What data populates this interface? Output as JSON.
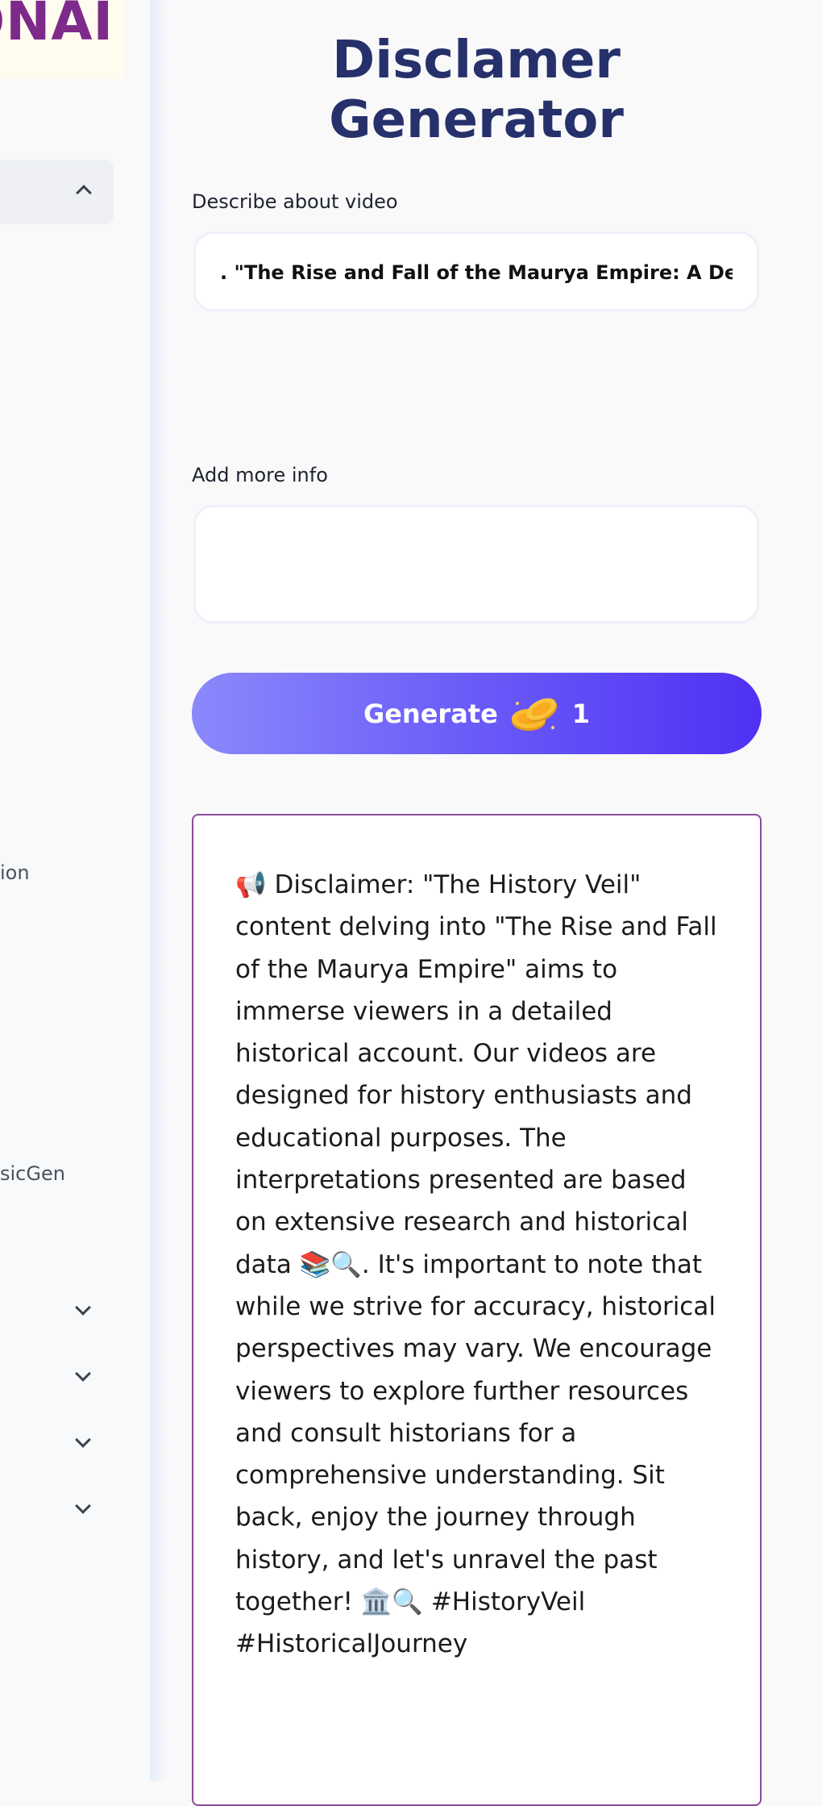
{
  "sidebar": {
    "logo_text": "ONAI",
    "labels": [
      "ion",
      "sicGen"
    ]
  },
  "main": {
    "title": "Disclamer Generator",
    "describe_label": "Describe about video",
    "describe_value": ". \"The Rise and Fall of the Maurya Empire: A Detailed",
    "more_info_label": "Add more info",
    "more_info_value": "",
    "generate_label": "Generate",
    "generate_cost": "1",
    "output_text": "📢 Disclaimer: \"The History Veil\" content delving into \"The Rise and Fall of the Maurya Empire\" aims to immerse viewers in a detailed historical account. Our videos are designed for history enthusiasts and educational purposes. The interpretations presented are based on extensive research and historical data 📚🔍. It's important to note that while we strive for accuracy, historical perspectives may vary. We encourage viewers to explore further resources and consult historians for a comprehensive understanding. Sit back, enjoy the journey through history, and let's unravel the past together! 🏛️🔍 #HistoryVeil #HistoricalJourney"
  },
  "colors": {
    "title": "#26316b",
    "logo": "#7d2a8b",
    "button_start": "#8a89fb",
    "button_end": "#4f31f4",
    "output_border": "#8a4a9a"
  },
  "icons": [
    "chevron-up-icon",
    "chevron-down-icon",
    "coins-icon"
  ]
}
